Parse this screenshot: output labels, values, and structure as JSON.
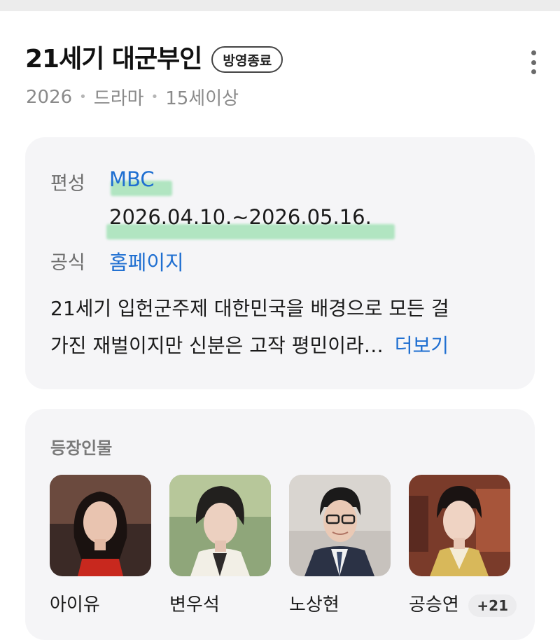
{
  "header": {
    "title": "21세기 대군부인",
    "status_badge": "방영종료",
    "meta": {
      "year": "2026",
      "genre": "드라마",
      "rating": "15세이상"
    }
  },
  "info": {
    "broadcast_label": "편성",
    "broadcaster": "MBC",
    "air_dates": "2026.04.10.~2026.05.16.",
    "official_label": "공식",
    "homepage": "홈페이지",
    "description_line1": "21세기 입헌군주제 대한민국을 배경으로 모든 걸",
    "description_line2": "가진 재벌이지만 신분은 고작 평민이라…",
    "more_label": "더보기"
  },
  "cast": {
    "section_title": "등장인물",
    "members": [
      {
        "name": "아이유",
        "icon": "actor-photo"
      },
      {
        "name": "변우석",
        "icon": "actor-photo"
      },
      {
        "name": "노상현",
        "icon": "actor-photo"
      },
      {
        "name": "공승연",
        "icon": "actor-photo"
      }
    ],
    "more_count": "+21"
  },
  "colors": {
    "link": "#1f6fd1",
    "highlight": "#78d796",
    "card_bg": "#f5f5f7"
  }
}
